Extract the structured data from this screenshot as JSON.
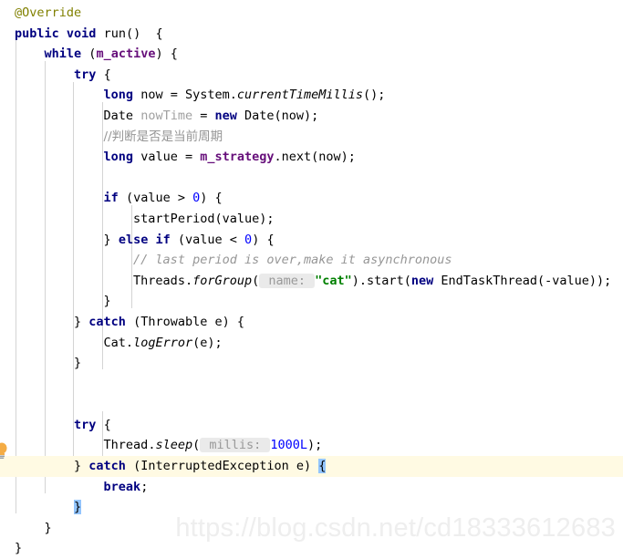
{
  "editor": {
    "language": "Java",
    "font_size_px": 13.5,
    "line_height_px": 22.6,
    "background": "#ffffff",
    "highlight_line_background": "#fffae3",
    "matched_brace_background": "#93c5fd",
    "indent_guide_color": "#d4d4d4",
    "colors": {
      "keyword": "#000080",
      "field": "#660e7a",
      "annotation": "#808000",
      "comment": "#969696",
      "string": "#008000",
      "number": "#0000ff",
      "plain_text": "#000000",
      "unused_identifier": "#a0a0a0",
      "param_hint_background": "#eaeaea",
      "param_hint_text": "#999999"
    }
  },
  "gutter": {
    "intention_bulb_icon": "lightbulb-icon",
    "intention_bulb_line": 25
  },
  "code": {
    "lines": [
      "@Override",
      "public void run() {",
      "    while (m_active) {",
      "        try {",
      "            long now = System.currentTimeMillis();",
      "            Date nowTime = new Date(now);",
      "            //判断是否是当前周期",
      "            long value = m_strategy.next(now);",
      "",
      "            if (value > 0) {",
      "                startPeriod(value);",
      "            } else if (value < 0) {",
      "                // last period is over,make it asynchronous",
      "                Threads.forGroup( name: \"cat\").start(new EndTaskThread(-value));",
      "            }",
      "        } catch (Throwable e) {",
      "            Cat.logError(e);",
      "        }",
      "",
      "",
      "        try {",
      "            Thread.sleep( millis: 1000L);",
      "        } catch (InterruptedException e) {",
      "            break;",
      "        }",
      "    }",
      "}"
    ],
    "annotations": {
      "override": "@Override",
      "chinese_comment": "//判断是否是当前周期",
      "async_comment": "// last period is over,make it asynchronous"
    },
    "parameter_hints": [
      {
        "name": "name:",
        "value": "\"cat\"",
        "line": 14
      },
      {
        "name": "millis:",
        "value": "1000L",
        "line": 22
      }
    ],
    "identifiers": {
      "field_active": "m_active",
      "field_strategy": "m_strategy",
      "unused_variable": "nowTime"
    }
  },
  "watermark": {
    "text": "https://blog.csdn.net/cd18333612683",
    "color": "#eeeeee"
  }
}
